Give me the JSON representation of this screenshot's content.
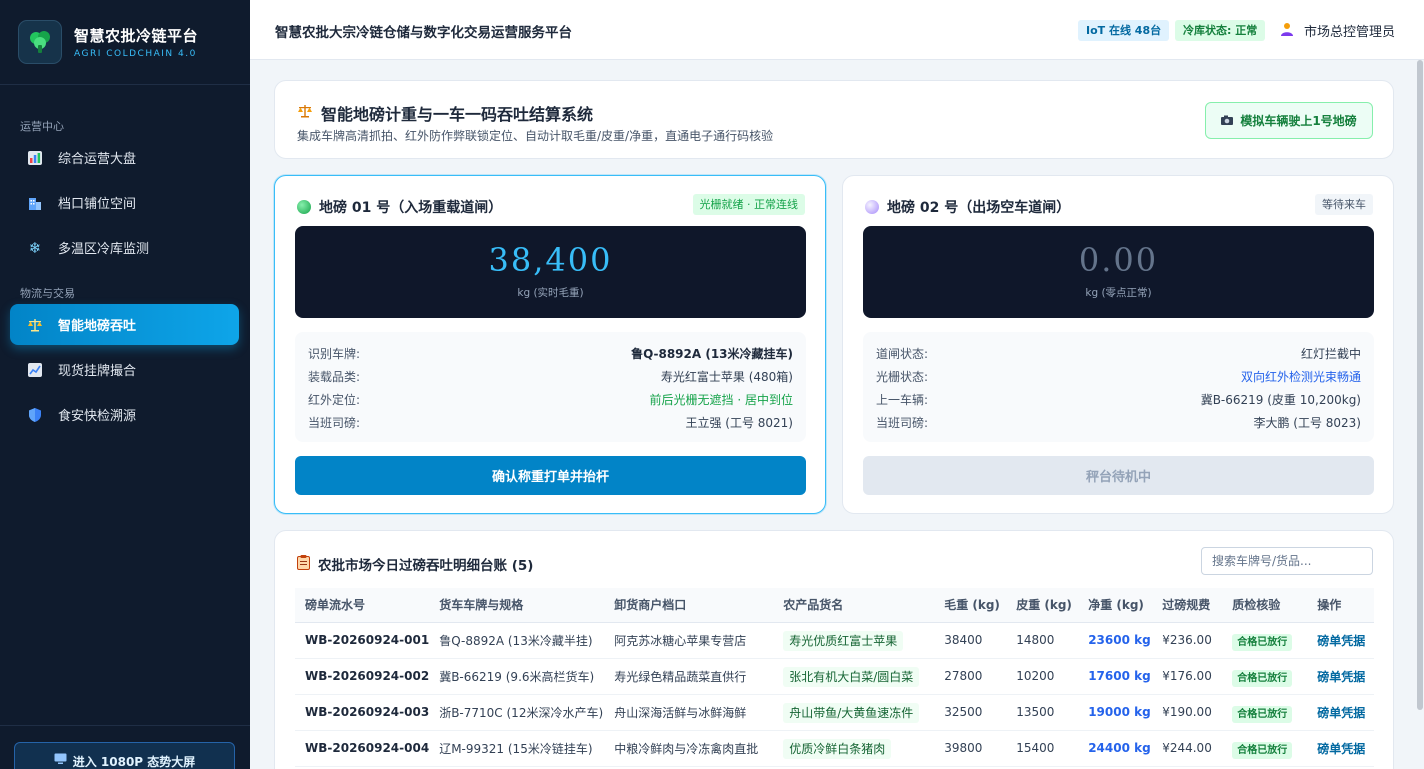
{
  "brand": {
    "title": "智慧农批冷链平台",
    "subtitle": "AGRI COLDCHAIN 4.0"
  },
  "sidebar": {
    "sections": [
      "运营中心",
      "物流与交易"
    ],
    "items": [
      {
        "label": "综合运营大盘",
        "icon": "bar-chart-icon"
      },
      {
        "label": "档口铺位空间",
        "icon": "building-icon"
      },
      {
        "label": "多温区冷库监测",
        "icon": "snowflake-icon"
      },
      {
        "label": "智能地磅吞吐",
        "icon": "scale-icon",
        "active": true
      },
      {
        "label": "现货挂牌撮合",
        "icon": "trend-icon"
      },
      {
        "label": "食安快检溯源",
        "icon": "shield-icon"
      }
    ],
    "bigscreen_label": "进入 1080P 态势大屏"
  },
  "topbar": {
    "title": "智慧农批大宗冷链仓储与数字化交易运营服务平台",
    "iot": "IoT 在线 48台",
    "cold": "冷库状态: 正常",
    "user": "市场总控管理员"
  },
  "header": {
    "title": "智能地磅计重与一车一码吞吐结算系统",
    "desc": "集成车牌高清抓拍、红外防作弊联锁定位、自动计取毛重/皮重/净重，直通电子通行码核验",
    "sim_button": "模拟车辆驶上1号地磅"
  },
  "scale1": {
    "title": "地磅 01 号（入场重载道闸）",
    "badge": "光栅就绪 · 正常连线",
    "reading": "38,400",
    "unit": "kg (实时毛重)",
    "rows": [
      {
        "k": "识别车牌:",
        "v": "鲁Q-8892A (13米冷藏挂车)"
      },
      {
        "k": "装载品类:",
        "v": "寿光红富士苹果 (480箱)"
      },
      {
        "k": "红外定位:",
        "v": "前后光栅无遮挡 · 居中到位"
      },
      {
        "k": "当班司磅:",
        "v": "王立强 (工号 8021)"
      }
    ],
    "action": "确认称重打单并抬杆"
  },
  "scale2": {
    "title": "地磅 02 号（出场空车道闸）",
    "badge": "等待来车",
    "reading": "0.00",
    "unit": "kg (零点正常)",
    "rows": [
      {
        "k": "道闸状态:",
        "v": "红灯拦截中"
      },
      {
        "k": "光栅状态:",
        "v": "双向红外检测光束畅通"
      },
      {
        "k": "上一车辆:",
        "v": "冀B-66219 (皮重 10,200kg)"
      },
      {
        "k": "当班司磅:",
        "v": "李大鹏 (工号 8023)"
      }
    ],
    "action": "秤台待机中"
  },
  "ledger": {
    "title": "农批市场今日过磅吞吐明细台账 (5)",
    "search_placeholder": "搜索车牌号/货品...",
    "columns": [
      "磅单流水号",
      "货车车牌与规格",
      "卸货商户档口",
      "农产品货名",
      "毛重 (kg)",
      "皮重 (kg)",
      "净重 (kg)",
      "过磅规费",
      "质检核验",
      "操作"
    ],
    "rows": [
      {
        "id": "WB-20260924-001",
        "truck": "鲁Q-8892A (13米冷藏半挂)",
        "merchant": "阿克苏冰糖心苹果专营店",
        "goods": "寿光优质红富士苹果",
        "gross": "38400",
        "tare": "14800",
        "net": "23600 kg",
        "fee": "¥236.00",
        "qc": "合格已放行",
        "op": "磅单凭据"
      },
      {
        "id": "WB-20260924-002",
        "truck": "冀B-66219 (9.6米高栏货车)",
        "merchant": "寿光绿色精品蔬菜直供行",
        "goods": "张北有机大白菜/圆白菜",
        "gross": "27800",
        "tare": "10200",
        "net": "17600 kg",
        "fee": "¥176.00",
        "qc": "合格已放行",
        "op": "磅单凭据"
      },
      {
        "id": "WB-20260924-003",
        "truck": "浙B-7710C (12米深冷水产车)",
        "merchant": "舟山深海活鲜与冰鲜海鲜",
        "goods": "舟山带鱼/大黄鱼速冻件",
        "gross": "32500",
        "tare": "13500",
        "net": "19000 kg",
        "fee": "¥190.00",
        "qc": "合格已放行",
        "op": "磅单凭据"
      },
      {
        "id": "WB-20260924-004",
        "truck": "辽M-99321 (15米冷链挂车)",
        "merchant": "中粮冷鲜肉与冷冻禽肉直批",
        "goods": "优质冷鲜白条猪肉",
        "gross": "39800",
        "tare": "15400",
        "net": "24400 kg",
        "fee": "¥244.00",
        "qc": "合格已放行",
        "op": "磅单凭据"
      }
    ]
  }
}
